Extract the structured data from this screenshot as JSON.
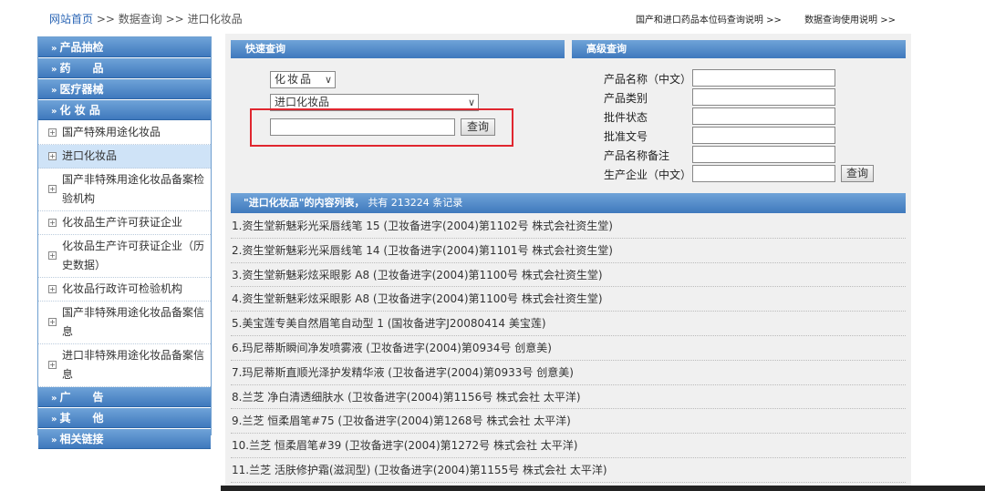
{
  "breadcrumb": {
    "home": "网站首页",
    "sep": ">>",
    "level1": "数据查询",
    "level2": "进口化妆品"
  },
  "toplinks": [
    "国产和进口药品本位码查询说明 >>",
    "数据查询使用说明 >>"
  ],
  "sidebar": {
    "cat_top": [
      {
        "label": "产品抽检"
      },
      {
        "label": "药　　品"
      },
      {
        "label": "医疗器械"
      },
      {
        "label": "化 妆 品"
      }
    ],
    "subitems": [
      {
        "label": "国产特殊用途化妆品"
      },
      {
        "label": "进口化妆品"
      },
      {
        "label": "国产非特殊用途化妆品备案检验机构"
      },
      {
        "label": "化妆品生产许可获证企业"
      },
      {
        "label": "化妆品生产许可获证企业（历史数据）"
      },
      {
        "label": "化妆品行政许可检验机构"
      },
      {
        "label": "国产非特殊用途化妆品备案信息"
      },
      {
        "label": "进口非特殊用途化妆品备案信息"
      }
    ],
    "cat_bottom": [
      {
        "label": "广　　告"
      },
      {
        "label": "其　　他"
      },
      {
        "label": "相关链接"
      }
    ]
  },
  "quick": {
    "title": "快速查询",
    "category_select": "化妆品",
    "subcategory_select": "进口化妆品",
    "search_value": "",
    "button": "查询"
  },
  "advanced": {
    "title": "高级查询",
    "fields": [
      {
        "label": "产品名称（中文）",
        "value": ""
      },
      {
        "label": "产品类别",
        "value": ""
      },
      {
        "label": "批件状态",
        "value": ""
      },
      {
        "label": "批准文号",
        "value": ""
      },
      {
        "label": "产品名称备注",
        "value": ""
      },
      {
        "label": "生产企业（中文）",
        "value": ""
      }
    ],
    "button": "查询"
  },
  "list": {
    "header_title": "\"进口化妆品\"的内容列表，",
    "header_count": "共有 213224 条记录",
    "items": [
      "1.资生堂新魅彩光采唇线笔 15 (卫妆备进字(2004)第1102号 株式会社资生堂)",
      "2.资生堂新魅彩光采唇线笔 14 (卫妆备进字(2004)第1101号 株式会社资生堂)",
      "3.资生堂新魅彩炫采眼影 A8 (卫妆备进字(2004)第1100号 株式会社资生堂)",
      "4.资生堂新魅彩炫采眼影 A8 (卫妆备进字(2004)第1100号 株式会社资生堂)",
      "5.美宝莲专美自然眉笔自动型 1 (国妆备进字J20080414 美宝莲)",
      "6.玛尼蒂斯瞬间净发喷雾液 (卫妆备进字(2004)第0934号 创意美)",
      "7.玛尼蒂斯直顺光泽护发精华液 (卫妆备进字(2004)第0933号 创意美)",
      "8.兰芝 净白清透细肤水 (卫妆备进字(2004)第1156号 株式会社 太平洋)",
      "9.兰芝 恒柔眉笔#75 (卫妆备进字(2004)第1268号 株式会社 太平洋)",
      "10.兰芝 恒柔眉笔#39 (卫妆备进字(2004)第1272号 株式会社 太平洋)",
      "11.兰芝 活肤修护霜(滋润型) (卫妆备进字(2004)第1155号 株式会社 太平洋)"
    ]
  }
}
